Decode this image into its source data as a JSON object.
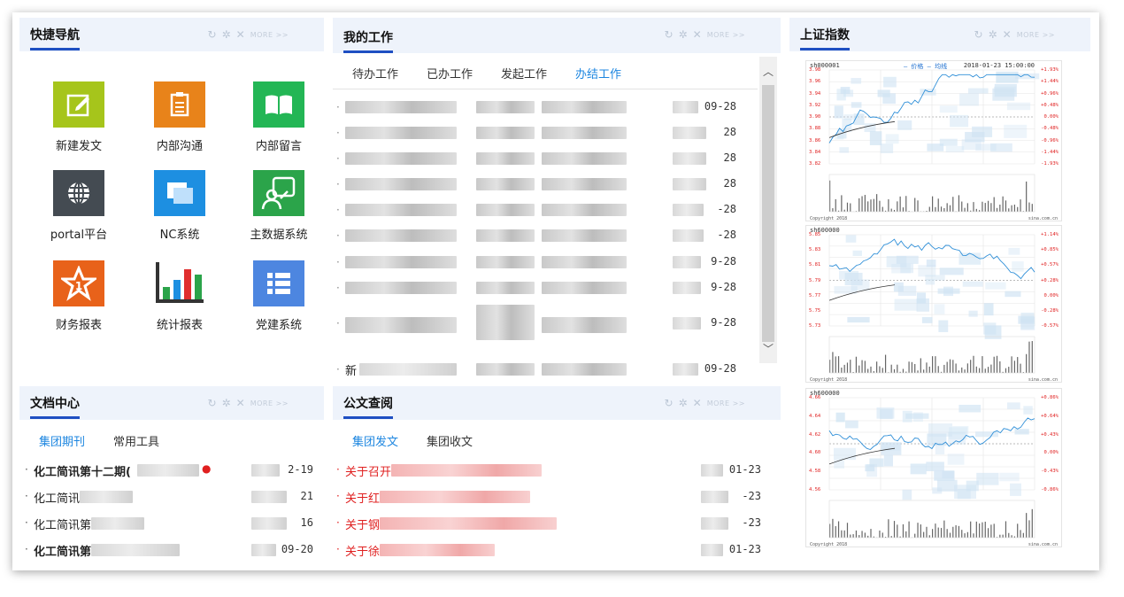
{
  "quick_nav": {
    "title": "快捷导航",
    "items": [
      {
        "label": "新建发文",
        "icon": "pencil-edit-icon",
        "color": "#a6c51b"
      },
      {
        "label": "内部沟通",
        "icon": "clipboard-icon",
        "color": "#e8831a"
      },
      {
        "label": "内部留言",
        "icon": "open-book-icon",
        "color": "#23b655"
      },
      {
        "label": "portal平台",
        "icon": "globe-icon",
        "color": "#444b52"
      },
      {
        "label": "NC系统",
        "icon": "windows-icon",
        "color": "#1d8fe1"
      },
      {
        "label": "主数据系统",
        "icon": "user-card-icon",
        "color": "#2ba44a"
      },
      {
        "label": "财务报表",
        "icon": "star-badge-icon",
        "color": "#e8621a"
      },
      {
        "label": "统计报表",
        "icon": "bar-chart-icon",
        "color": "#ffffff"
      },
      {
        "label": "党建系统",
        "icon": "list-icon",
        "color": "#4d86e0"
      }
    ]
  },
  "my_work": {
    "title": "我的工作",
    "tabs": [
      "待办工作",
      "已办工作",
      "发起工作",
      "办结工作"
    ],
    "active_tab": 3,
    "rows": [
      {
        "date": "09-28"
      },
      {
        "date": "28"
      },
      {
        "date": "28"
      },
      {
        "date": "28"
      },
      {
        "date": "-28"
      },
      {
        "date": "-28"
      },
      {
        "date": "9-28"
      },
      {
        "date": "9-28"
      },
      {
        "date": "9-28"
      },
      {
        "date": "09-28"
      }
    ],
    "last_row_prefix": "新"
  },
  "shanghai_index": {
    "title": "上证指数"
  },
  "doc_center": {
    "title": "文档中心",
    "tabs": [
      "集团期刊",
      "常用工具"
    ],
    "active_tab": 0,
    "rows": [
      {
        "text": "化工简讯第十二期(",
        "date": "2-19",
        "bold": true,
        "dot": true
      },
      {
        "text": "化工简讯",
        "date": "21",
        "bold": false,
        "dot": false
      },
      {
        "text": "化工简讯第",
        "date": "16",
        "bold": false,
        "dot": false
      },
      {
        "text": "化工简讯第",
        "date": "09-20",
        "bold": true,
        "dot": false
      }
    ]
  },
  "official_docs": {
    "title": "公文查阅",
    "tabs": [
      "集团发文",
      "集团收文"
    ],
    "active_tab": 0,
    "rows": [
      {
        "text": "关于召开",
        "date": "01-23"
      },
      {
        "text": "关于红",
        "date": "-23"
      },
      {
        "text": "关于钢",
        "date": "-23"
      },
      {
        "text": "关于徐",
        "date": "01-23"
      }
    ]
  },
  "toolbar": {
    "more_label": "MORE >>"
  },
  "charts": [
    {
      "header": "sh000001  ",
      "legend": "— 价格  — 均线",
      "right_header": "2018-01-23 15:00:00",
      "left_ticks": [
        "3.98",
        "3.96",
        "3.94",
        "3.92",
        "3.90",
        "3.88",
        "3.86",
        "3.84",
        "3.82"
      ],
      "right_ticks": [
        "+1.93%",
        "+1.44%",
        "+0.96%",
        "+0.48%",
        "0.00%",
        "-0.48%",
        "-0.96%",
        "-1.44%",
        "-1.93%"
      ]
    },
    {
      "header": "sh600000",
      "legend": "",
      "right_header": "",
      "left_ticks": [
        "5.85",
        "5.83",
        "5.81",
        "5.79",
        "5.77",
        "5.75",
        "5.73"
      ],
      "right_ticks": [
        "+1.14%",
        "+0.85%",
        "+0.57%",
        "+0.28%",
        "0.00%",
        "-0.28%",
        "-0.57%"
      ]
    },
    {
      "header": "sh600000",
      "legend": "",
      "right_header": "",
      "left_ticks": [
        "4.66",
        "4.64",
        "4.62",
        "4.60",
        "4.58",
        "4.56"
      ],
      "right_ticks": [
        "+0.86%",
        "+0.64%",
        "+0.43%",
        "0.00%",
        "-0.43%",
        "-0.86%"
      ]
    }
  ]
}
